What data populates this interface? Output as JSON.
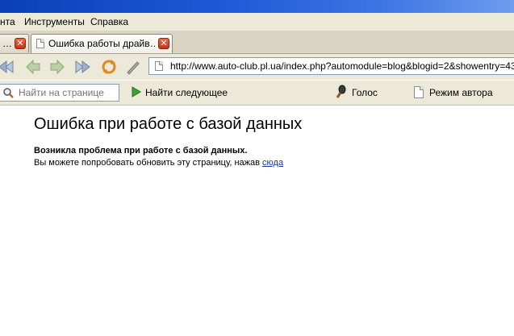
{
  "menu": {
    "items": [
      "нта",
      "Инструменты",
      "Справка"
    ]
  },
  "tabs": [
    {
      "label": "…"
    },
    {
      "label": "Ошибка работы драйв…"
    }
  ],
  "toolbar": {
    "url": "http://www.auto-club.pl.ua/index.php?automodule=blog&blogid=2&showentry=43"
  },
  "findbar": {
    "placeholder": "Найти на странице",
    "find_next": "Найти следующее",
    "voice": "Голос",
    "author_mode": "Режим автора"
  },
  "page": {
    "heading": "Ошибка при работе с базой данных",
    "bold_line": "Возникла проблема при работе с базой данных.",
    "line_prefix": "Вы можете попробовать обновить эту страницу, нажав ",
    "link": "сюда"
  },
  "colors": {
    "titlebar": "#0a3fb8",
    "chrome": "#ece9d8",
    "link": "#1a35a8",
    "close_button": "#c23314"
  }
}
